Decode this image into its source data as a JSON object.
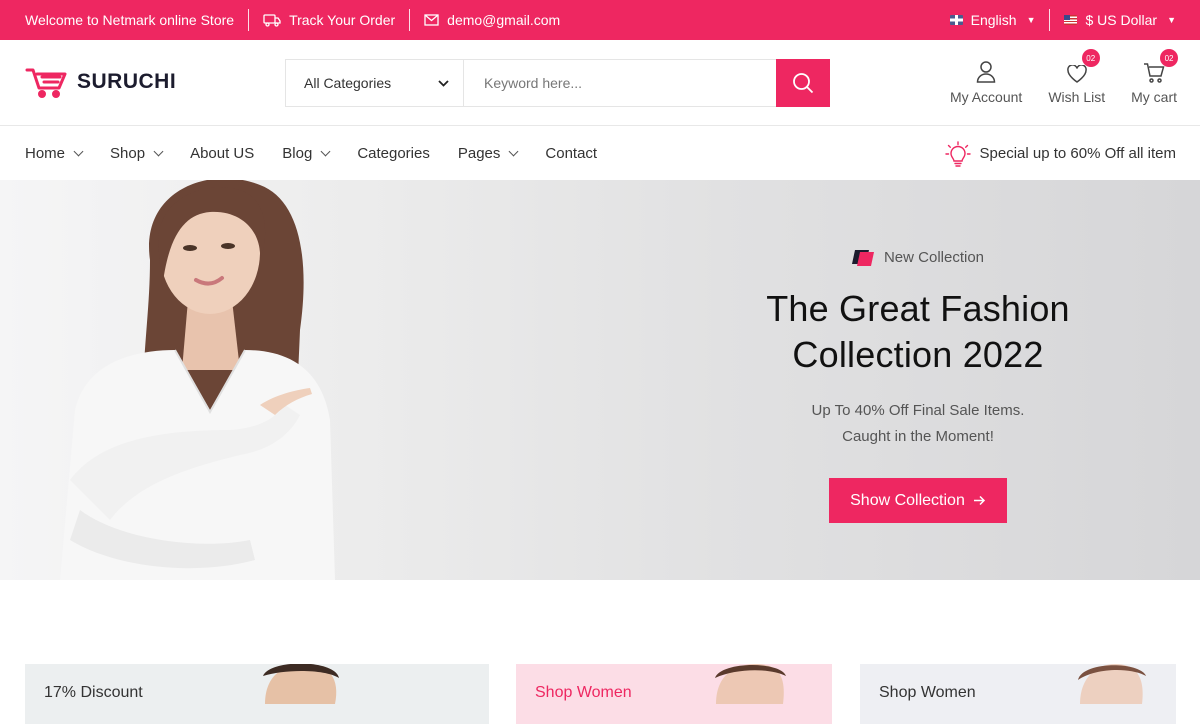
{
  "topbar": {
    "welcome": "Welcome to Netmark online Store",
    "track_order": "Track Your Order",
    "email": "demo@gmail.com",
    "language": "English",
    "currency": "$ US Dollar",
    "icons": [
      "truck-icon",
      "mail-icon",
      "uk-flag-icon",
      "us-flag-icon"
    ]
  },
  "brand": {
    "name": "SURUCHI",
    "accent": "#ee2761"
  },
  "search": {
    "category": "All Categories",
    "placeholder": "Keyword here..."
  },
  "header_actions": {
    "account": "My Account",
    "wishlist": "Wish List",
    "wishlist_count": "02",
    "cart": "My cart",
    "cart_count": "02"
  },
  "nav": {
    "items": [
      {
        "label": "Home"
      },
      {
        "label": "Shop"
      },
      {
        "label": "About US"
      },
      {
        "label": "Blog"
      },
      {
        "label": "Categories"
      },
      {
        "label": "Pages"
      },
      {
        "label": "Contact"
      }
    ],
    "promo": "Special up to 60% Off all item"
  },
  "hero": {
    "tag": "New Collection",
    "title_line1": "The Great Fashion",
    "title_line2": "Collection 2022",
    "sub_line1": "Up To 40% Off Final Sale Items.",
    "sub_line2": "Caught in the Moment!",
    "button": "Show Collection"
  },
  "banners": [
    {
      "text": "17% Discount"
    },
    {
      "text": "Shop Women"
    },
    {
      "text": "Shop Women"
    }
  ]
}
